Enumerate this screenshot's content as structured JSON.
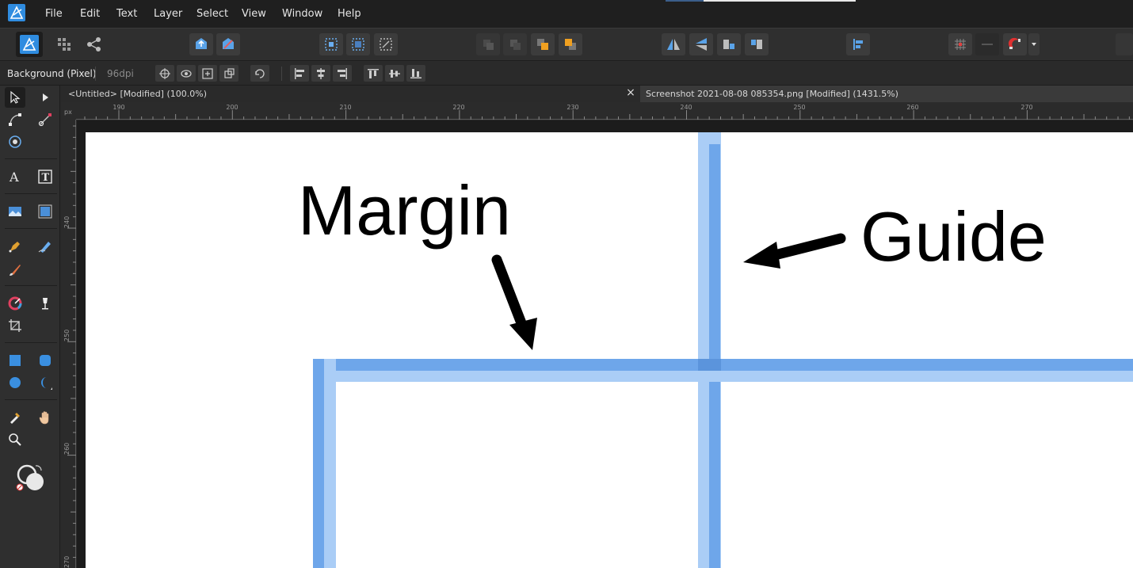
{
  "menu": [
    "File",
    "Edit",
    "Text",
    "Layer",
    "Select",
    "View",
    "Window",
    "Help"
  ],
  "context": {
    "layer": "Background (Pixel)",
    "dpi": "96dpi"
  },
  "tabs": {
    "untitled": "<Untitled> [Modified] (100.0%)",
    "close": "×",
    "screenshot": "Screenshot 2021-08-08 085354.png [Modified] (1431.5%)"
  },
  "ruler": {
    "unit": "px",
    "h_labels": [
      "190",
      "200",
      "210",
      "220",
      "230",
      "240",
      "250",
      "260",
      "270"
    ],
    "v_labels": [
      "240",
      "250",
      "260",
      "270"
    ]
  },
  "annotations": {
    "margin": "Margin",
    "guide": "Guide"
  },
  "colors": {
    "guide_blue": "#5b9be6",
    "guide_light": "#aacdf6",
    "accent": "#2f8ce0"
  }
}
